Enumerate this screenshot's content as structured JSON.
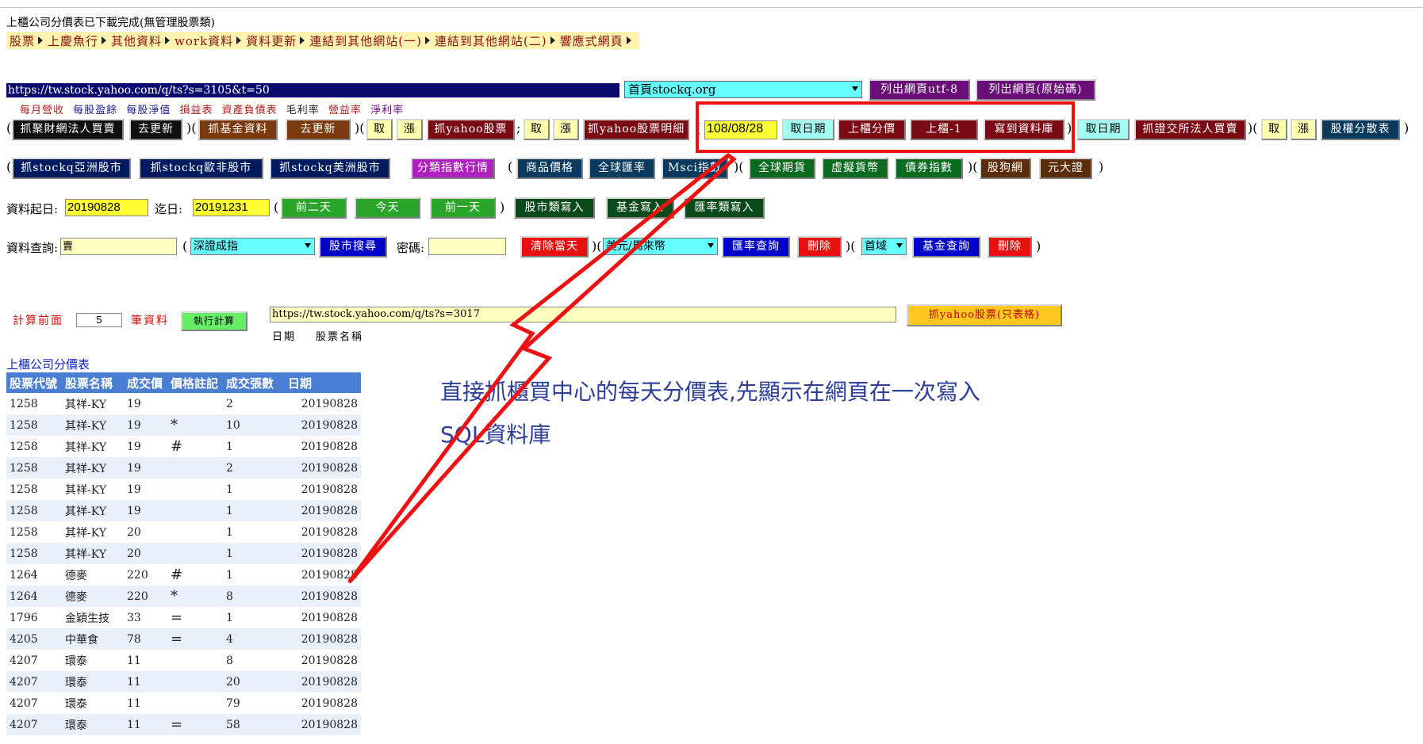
{
  "status_text": "上櫃公司分價表已下載完成(無管理股票類)",
  "menu": [
    "股票",
    "上慶魚行",
    "其他資料",
    "work資料",
    "資料更新",
    "連結到其他網站(一)",
    "連結到其他網站(二)",
    "響應式網頁"
  ],
  "url_input": "https://tw.stock.yahoo.com/q/ts?s=3105&t=50",
  "site_select": "首頁stockq.org",
  "btn_list_utf8": "列出網頁utf-8",
  "btn_list_source": "列出網頁(原始碼)",
  "links": [
    "每月營收",
    "每股盈餘",
    "每股淨值",
    "損益表",
    "資產負債表",
    "毛利率",
    "營益率",
    "淨利率"
  ],
  "row1": {
    "b1": "抓聚財網法人買賣",
    "b2": "去更新",
    "b3": "抓基金資料",
    "b4": "去更新",
    "b5": "取",
    "b6": "漲",
    "b7": "抓yahoo股票",
    "b8": "取",
    "b9": "漲",
    "b10": "抓yahoo股票明細",
    "date_input": "108/08/28",
    "b11": "取日期",
    "b12": "上櫃分價",
    "b13": "上櫃-1",
    "b14": "寫到資料庫",
    "b15": "取日期",
    "b16": "抓證交所法人買賣",
    "b17": "取",
    "b18": "漲",
    "b19": "股權分散表"
  },
  "row2": [
    "抓stockq亞洲股市",
    "抓stockq歐非股市",
    "抓stockq美洲股市",
    "分類指數行情",
    "商品價格",
    "全球匯率",
    "Msci指數",
    "全球期貨",
    "虛擬貨幣",
    "債券指數",
    "股狗網",
    "元大證"
  ],
  "row3": {
    "start_label": "資料起日:",
    "start_value": "20190828",
    "end_label": "迄日:",
    "end_value": "20191231",
    "b1": "前二天",
    "b2": "今天",
    "b3": "前一天",
    "b4": "股市類寫入",
    "b5": "基金寫入",
    "b6": "匯率類寫入"
  },
  "row4": {
    "query_label": "資料查詢:",
    "query_value": "賣",
    "index_select": "深證成指",
    "b_search": "股市搜尋",
    "pwd_label": "密碼:",
    "b_clear": "清除當天",
    "fx_select": "美元/馬來幣",
    "b_fx": "匯率查詢",
    "b_del1": "刪除",
    "fund_select": "首域",
    "b_fund": "基金查詢",
    "b_del2": "刪除"
  },
  "calc": {
    "label_pre": "計算前面",
    "days": "5",
    "label_post": "筆資料",
    "b_run": "執行計算",
    "url2": "https://tw.stock.yahoo.com/q/ts?s=3017",
    "b_yahoo_table": "抓yahoo股票(只表格)",
    "sub_date": "日期",
    "sub_name": "股票名稱"
  },
  "table_title": "上櫃公司分價表",
  "table": {
    "headers": [
      "股票代號",
      "股票名稱",
      "成交價",
      "價格註記",
      "成交張數",
      "日期"
    ],
    "rows": [
      [
        "1258",
        "其祥-KY",
        "19",
        "",
        "2",
        "20190828"
      ],
      [
        "1258",
        "其祥-KY",
        "19",
        "*",
        "10",
        "20190828"
      ],
      [
        "1258",
        "其祥-KY",
        "19",
        "#",
        "1",
        "20190828"
      ],
      [
        "1258",
        "其祥-KY",
        "19",
        "",
        "2",
        "20190828"
      ],
      [
        "1258",
        "其祥-KY",
        "19",
        "",
        "1",
        "20190828"
      ],
      [
        "1258",
        "其祥-KY",
        "19",
        "",
        "1",
        "20190828"
      ],
      [
        "1258",
        "其祥-KY",
        "20",
        "",
        "1",
        "20190828"
      ],
      [
        "1258",
        "其祥-KY",
        "20",
        "",
        "1",
        "20190828"
      ],
      [
        "1264",
        "德麥",
        "220",
        "#",
        "1",
        "20190828"
      ],
      [
        "1264",
        "德麥",
        "220",
        "*",
        "8",
        "20190828"
      ],
      [
        "1796",
        "金穎生技",
        "33",
        "=",
        "1",
        "20190828"
      ],
      [
        "4205",
        "中華食",
        "78",
        "=",
        "4",
        "20190828"
      ],
      [
        "4207",
        "環泰",
        "11",
        "",
        "8",
        "20190828"
      ],
      [
        "4207",
        "環泰",
        "11",
        "",
        "20",
        "20190828"
      ],
      [
        "4207",
        "環泰",
        "11",
        "",
        "79",
        "20190828"
      ],
      [
        "4207",
        "環泰",
        "11",
        "=",
        "58",
        "20190828"
      ]
    ]
  },
  "annotation": "直接抓櫃買中心的每天分價表,先顯示在網頁在一次寫入SQL資料庫",
  "colors": {
    "highlight": "#ee1111",
    "table_header": "#4a7ed2",
    "annotation": "#2c3e9a"
  }
}
